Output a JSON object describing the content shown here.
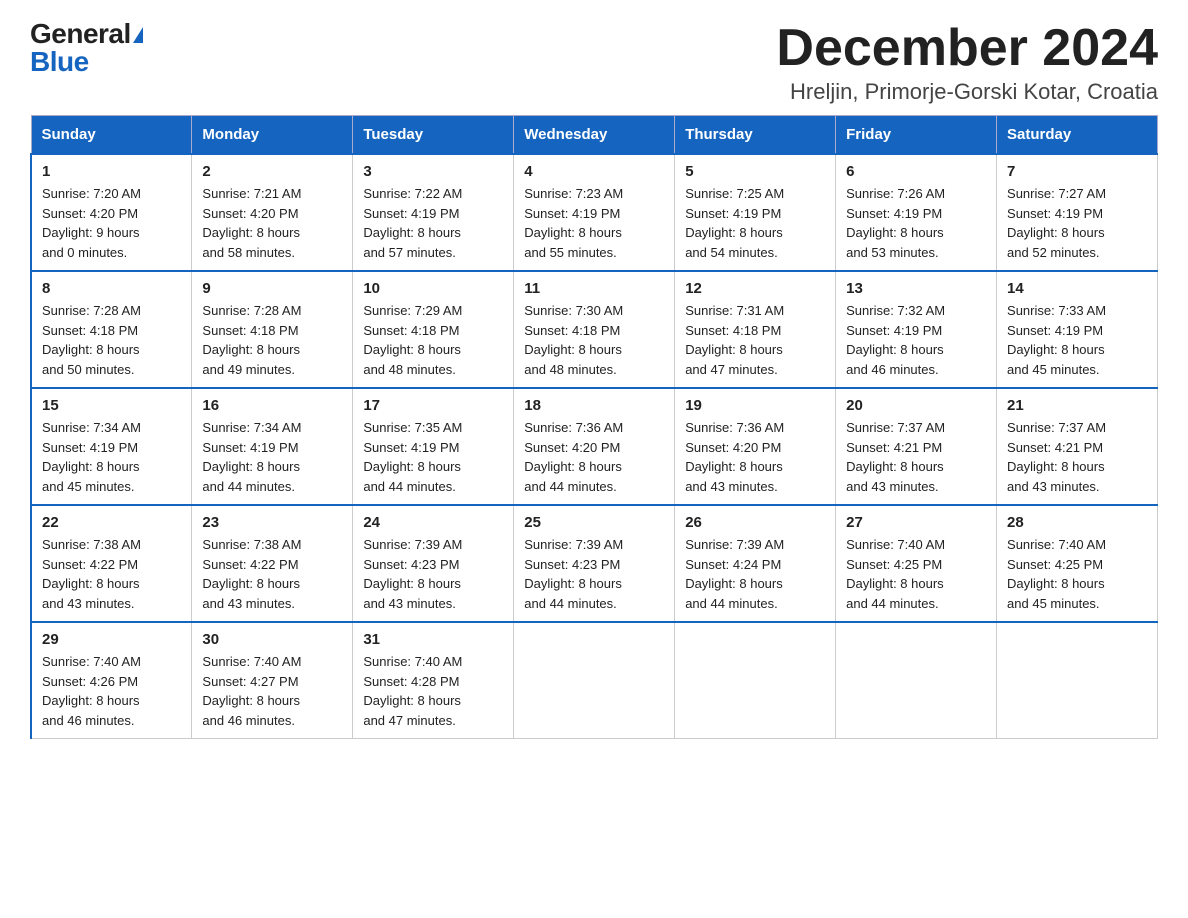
{
  "logo": {
    "general": "General",
    "blue": "Blue"
  },
  "title": "December 2024",
  "location": "Hreljin, Primorje-Gorski Kotar, Croatia",
  "weekdays": [
    "Sunday",
    "Monday",
    "Tuesday",
    "Wednesday",
    "Thursday",
    "Friday",
    "Saturday"
  ],
  "weeks": [
    [
      {
        "day": "1",
        "sunrise": "7:20 AM",
        "sunset": "4:20 PM",
        "daylight": "9 hours and 0 minutes."
      },
      {
        "day": "2",
        "sunrise": "7:21 AM",
        "sunset": "4:20 PM",
        "daylight": "8 hours and 58 minutes."
      },
      {
        "day": "3",
        "sunrise": "7:22 AM",
        "sunset": "4:19 PM",
        "daylight": "8 hours and 57 minutes."
      },
      {
        "day": "4",
        "sunrise": "7:23 AM",
        "sunset": "4:19 PM",
        "daylight": "8 hours and 55 minutes."
      },
      {
        "day": "5",
        "sunrise": "7:25 AM",
        "sunset": "4:19 PM",
        "daylight": "8 hours and 54 minutes."
      },
      {
        "day": "6",
        "sunrise": "7:26 AM",
        "sunset": "4:19 PM",
        "daylight": "8 hours and 53 minutes."
      },
      {
        "day": "7",
        "sunrise": "7:27 AM",
        "sunset": "4:19 PM",
        "daylight": "8 hours and 52 minutes."
      }
    ],
    [
      {
        "day": "8",
        "sunrise": "7:28 AM",
        "sunset": "4:18 PM",
        "daylight": "8 hours and 50 minutes."
      },
      {
        "day": "9",
        "sunrise": "7:28 AM",
        "sunset": "4:18 PM",
        "daylight": "8 hours and 49 minutes."
      },
      {
        "day": "10",
        "sunrise": "7:29 AM",
        "sunset": "4:18 PM",
        "daylight": "8 hours and 48 minutes."
      },
      {
        "day": "11",
        "sunrise": "7:30 AM",
        "sunset": "4:18 PM",
        "daylight": "8 hours and 48 minutes."
      },
      {
        "day": "12",
        "sunrise": "7:31 AM",
        "sunset": "4:18 PM",
        "daylight": "8 hours and 47 minutes."
      },
      {
        "day": "13",
        "sunrise": "7:32 AM",
        "sunset": "4:19 PM",
        "daylight": "8 hours and 46 minutes."
      },
      {
        "day": "14",
        "sunrise": "7:33 AM",
        "sunset": "4:19 PM",
        "daylight": "8 hours and 45 minutes."
      }
    ],
    [
      {
        "day": "15",
        "sunrise": "7:34 AM",
        "sunset": "4:19 PM",
        "daylight": "8 hours and 45 minutes."
      },
      {
        "day": "16",
        "sunrise": "7:34 AM",
        "sunset": "4:19 PM",
        "daylight": "8 hours and 44 minutes."
      },
      {
        "day": "17",
        "sunrise": "7:35 AM",
        "sunset": "4:19 PM",
        "daylight": "8 hours and 44 minutes."
      },
      {
        "day": "18",
        "sunrise": "7:36 AM",
        "sunset": "4:20 PM",
        "daylight": "8 hours and 44 minutes."
      },
      {
        "day": "19",
        "sunrise": "7:36 AM",
        "sunset": "4:20 PM",
        "daylight": "8 hours and 43 minutes."
      },
      {
        "day": "20",
        "sunrise": "7:37 AM",
        "sunset": "4:21 PM",
        "daylight": "8 hours and 43 minutes."
      },
      {
        "day": "21",
        "sunrise": "7:37 AM",
        "sunset": "4:21 PM",
        "daylight": "8 hours and 43 minutes."
      }
    ],
    [
      {
        "day": "22",
        "sunrise": "7:38 AM",
        "sunset": "4:22 PM",
        "daylight": "8 hours and 43 minutes."
      },
      {
        "day": "23",
        "sunrise": "7:38 AM",
        "sunset": "4:22 PM",
        "daylight": "8 hours and 43 minutes."
      },
      {
        "day": "24",
        "sunrise": "7:39 AM",
        "sunset": "4:23 PM",
        "daylight": "8 hours and 43 minutes."
      },
      {
        "day": "25",
        "sunrise": "7:39 AM",
        "sunset": "4:23 PM",
        "daylight": "8 hours and 44 minutes."
      },
      {
        "day": "26",
        "sunrise": "7:39 AM",
        "sunset": "4:24 PM",
        "daylight": "8 hours and 44 minutes."
      },
      {
        "day": "27",
        "sunrise": "7:40 AM",
        "sunset": "4:25 PM",
        "daylight": "8 hours and 44 minutes."
      },
      {
        "day": "28",
        "sunrise": "7:40 AM",
        "sunset": "4:25 PM",
        "daylight": "8 hours and 45 minutes."
      }
    ],
    [
      {
        "day": "29",
        "sunrise": "7:40 AM",
        "sunset": "4:26 PM",
        "daylight": "8 hours and 46 minutes."
      },
      {
        "day": "30",
        "sunrise": "7:40 AM",
        "sunset": "4:27 PM",
        "daylight": "8 hours and 46 minutes."
      },
      {
        "day": "31",
        "sunrise": "7:40 AM",
        "sunset": "4:28 PM",
        "daylight": "8 hours and 47 minutes."
      },
      null,
      null,
      null,
      null
    ]
  ],
  "labels": {
    "sunrise": "Sunrise:",
    "sunset": "Sunset:",
    "daylight": "Daylight:"
  }
}
